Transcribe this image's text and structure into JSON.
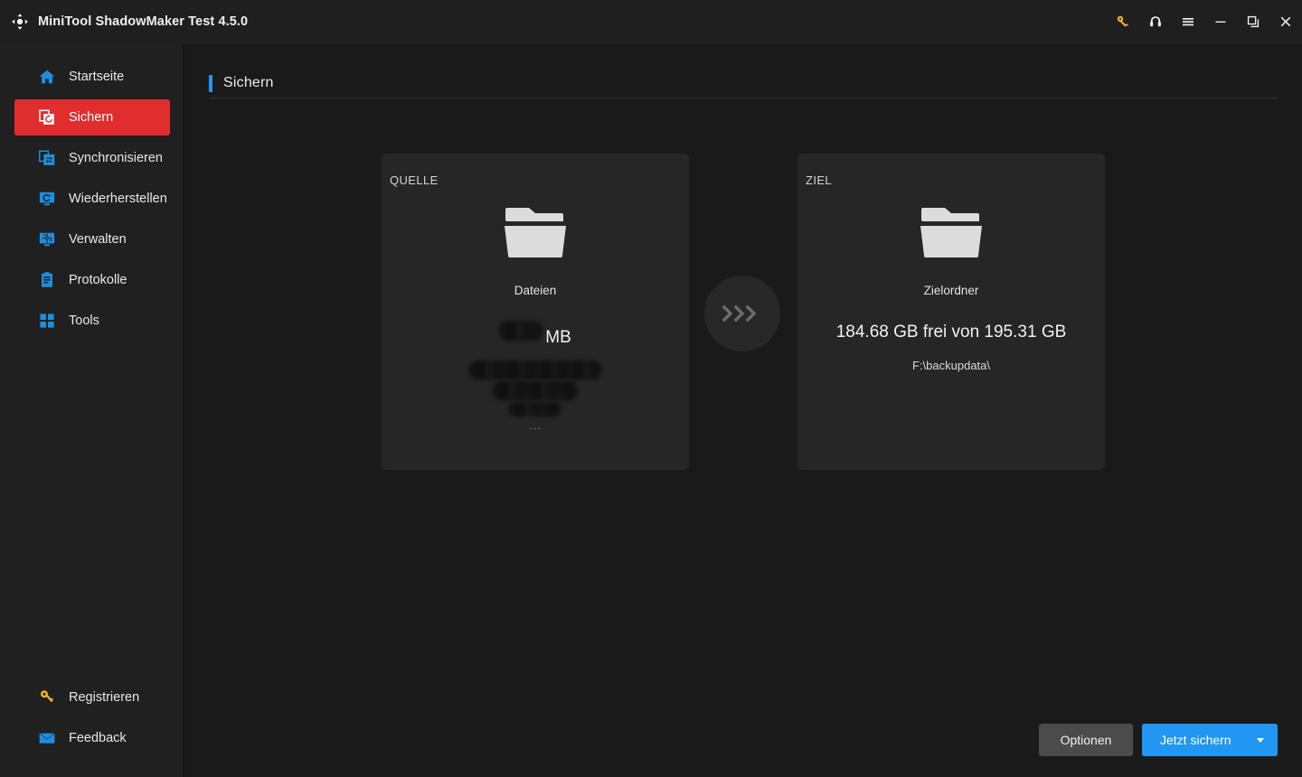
{
  "window": {
    "title": "MiniTool ShadowMaker Test 4.5.0",
    "logo_icon": "shadowmaker-arrows-logo",
    "controls": [
      {
        "name": "license-key-button",
        "icon": "key-icon",
        "color": "#f0b429"
      },
      {
        "name": "support-button",
        "icon": "headset-icon",
        "color": "#ededed"
      },
      {
        "name": "menu-button",
        "icon": "hamburger-menu-icon",
        "color": "#ededed"
      },
      {
        "name": "minimize-button",
        "icon": "minimize-icon",
        "color": "#ededed"
      },
      {
        "name": "maximize-button",
        "icon": "restore-window-icon",
        "color": "#ededed"
      },
      {
        "name": "close-button",
        "icon": "close-icon",
        "color": "#ededed"
      }
    ]
  },
  "sidebar": {
    "active_index": 1,
    "items": [
      {
        "label": "Startseite",
        "icon": "home-icon",
        "color": "#1e8fe0"
      },
      {
        "label": "Sichern",
        "icon": "backup-icon",
        "color": "#ffffff"
      },
      {
        "label": "Synchronisieren",
        "icon": "sync-icon",
        "color": "#1e8fe0"
      },
      {
        "label": "Wiederherstellen",
        "icon": "restore-icon",
        "color": "#1e8fe0"
      },
      {
        "label": "Verwalten",
        "icon": "manage-icon",
        "color": "#1e8fe0"
      },
      {
        "label": "Protokolle",
        "icon": "logs-icon",
        "color": "#1e8fe0"
      },
      {
        "label": "Tools",
        "icon": "tools-grid-icon",
        "color": "#1e8fe0"
      }
    ],
    "bottom_items": [
      {
        "label": "Registrieren",
        "icon": "key-icon",
        "color": "#f0b429"
      },
      {
        "label": "Feedback",
        "icon": "envelope-icon",
        "color": "#1e8fe0"
      }
    ]
  },
  "page": {
    "title": "Sichern",
    "accent_color": "#2196f3"
  },
  "source_card": {
    "label": "QUELLE",
    "folder_icon": "folder-icon",
    "type": "Dateien",
    "size_value": "[redacted]",
    "size_unit": "MB",
    "path_line_1": "[redacted]",
    "path_line_2": "[redacted]",
    "path_line_3": "[redacted]",
    "ellipsis": "..."
  },
  "transfer": {
    "icon": "triple-chevron-right-icon"
  },
  "dest_card": {
    "label": "ZIEL",
    "folder_icon": "folder-icon",
    "type": "Zielordner",
    "capacity": "184.68 GB frei von 195.31 GB",
    "path": "F:\\backupdata\\"
  },
  "footer": {
    "options_label": "Optionen",
    "backup_label": "Jetzt sichern",
    "backup_caret_icon": "chevron-down-icon",
    "backup_color": "#2196f3"
  }
}
